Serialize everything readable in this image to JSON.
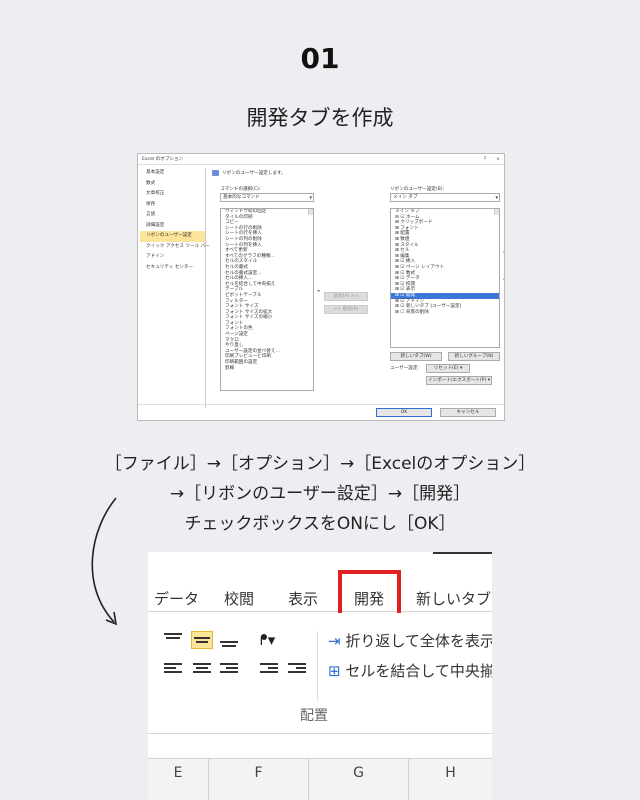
{
  "step_number": "01",
  "step_title": "開発タブを作成",
  "dialog": {
    "title": "Excel のオプション",
    "controls": [
      "?",
      "×"
    ],
    "sidebar": [
      "基本設定",
      "数式",
      "文章校正",
      "保存",
      "言語",
      "詳細設定",
      "リボンのユーザー設定",
      "クイック アクセス ツール バー",
      "アドイン",
      "セキュリティ センター"
    ],
    "sidebar_selected_index": 6,
    "header_text": "リボンのユーザー設定します。",
    "left_label": "コマンドの選択(C):",
    "left_combo": "基本的なコマンド",
    "left_list": [
      "ウィンドウ枠の固定",
      "タイルの印刷",
      "コピー",
      "シートの行の削除",
      "シートの行を挿入",
      "シートの列の削除",
      "シートの列を挿入",
      "すべて更新",
      "すべてのグラフの種類...",
      "セルのスタイル",
      "セルの書式",
      "セルの書式設定...",
      "セルの挿入...",
      "セルを結合して中央揃え",
      "テーブル",
      "ピボットテーブル",
      "フィルター",
      "フォント サイズ",
      "フォント サイズの拡大",
      "フォント サイズの縮小",
      "フォント",
      "フォントの色",
      "ページ設定",
      "マクロ",
      "やり直し",
      "ユーザー設定の並べ替え...",
      "印刷プレビューと印刷",
      "印刷範囲の設定",
      "罫線"
    ],
    "add_button": "追加(A) >>",
    "remove_button": "<< 削除(R)",
    "right_label": "リボンのユーザー設定(B):",
    "right_combo": "メイン タブ",
    "right_list": [
      "メイン タブ",
      "⊟ ☑ ホーム",
      "  ⊞ クリップボード",
      "  ⊞ フォント",
      "  ⊞ 配置",
      "  ⊞ 数値",
      "  ⊞ スタイル",
      "  ⊞ セル",
      "  ⊞ 編集",
      "⊞ ☑ 挿入",
      "⊞ ☑ ページ レイアウト",
      "⊞ ☑ 数式",
      "⊞ ☑ データ",
      "⊞ ☑ 校閲",
      "⊞ ☑ 表示",
      "⊞ ☑ 開発",
      "⊞ ☑ アドイン",
      "⊞ ☑ 新しいタブ (ユーザー設定)",
      "⊞ ☐ 背景の削除"
    ],
    "right_list_highlight_index": 15,
    "new_tab_button": "新しいタブ(W)",
    "new_group_button": "新しいグループ(N)",
    "user_settings_label": "ユーザー設定:",
    "reset_button": "リセット(E) ▾",
    "import_export_button": "インポート/エクスポート(P) ▾",
    "ok_button": "OK",
    "cancel_button": "キャンセル"
  },
  "instructions": {
    "line1": "［ファイル］→［オプション］→［Excelのオプション］",
    "line2": "→［リボンのユーザー設定］→［開発］",
    "line3": "チェックボックスをONにし［OK］"
  },
  "ribbon": {
    "tabs": [
      "データ",
      "校閲",
      "表示",
      "開発",
      "新しいタブ"
    ],
    "highlighted_tab": "開発",
    "wrap_text": "折り返して全体を表示す",
    "merge_center": "セルを結合して中央揃え",
    "group_label": "配置",
    "columns": [
      "E",
      "F",
      "G",
      "H"
    ],
    "colors": {
      "highlight": "#e02020",
      "icon_highlight": "#fbe59a"
    }
  }
}
